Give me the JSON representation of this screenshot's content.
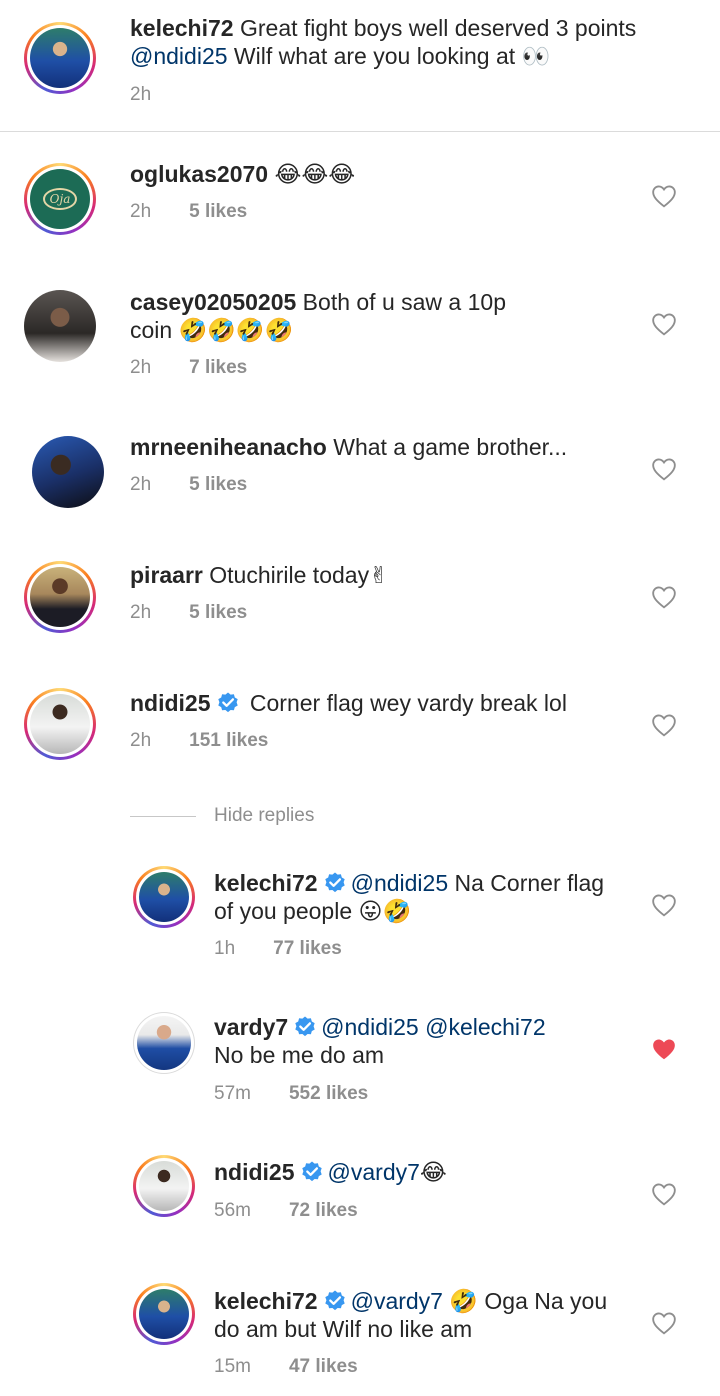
{
  "caption": {
    "username": "kelechi72",
    "text_line1": " Great fight boys well deserved 3 points",
    "mention": "@ndidi25",
    "text_line2_rest": " Wilf what are you looking at",
    "emoji": "👀",
    "time": "2h"
  },
  "comments": [
    {
      "username": "oglukas2070",
      "text": " ",
      "emoji": "😂😂😂",
      "time": "2h",
      "likes": "5 likes"
    },
    {
      "username": "casey02050205",
      "text_line1": " Both of u saw a 10p",
      "text_line2": "coin ",
      "emoji": "🤣🤣🤣🤣",
      "time": "2h",
      "likes": "7 likes"
    },
    {
      "username": "mrneeniheanacho",
      "text": " What a game brother...",
      "time": "2h",
      "likes": "5 likes"
    },
    {
      "username": "piraarr",
      "text": " Otuchirile today",
      "emoji": "✌",
      "time": "2h",
      "likes": "5 likes"
    },
    {
      "username": "ndidi25",
      "text": " Corner flag wey vardy break lol",
      "time": "2h",
      "likes": "151 likes"
    }
  ],
  "hide_replies": "Hide replies",
  "replies": [
    {
      "username": "kelechi72",
      "mention": "@ndidi25",
      "text_line1_rest": " Na Corner flag",
      "text_line2": "of you people ",
      "emoji": "😛🤣",
      "time": "1h",
      "likes": "77 likes"
    },
    {
      "username": "vardy7",
      "mention": "@ndidi25",
      "mention2": "@kelechi72",
      "text_line2": "No be me do am",
      "time": "57m",
      "likes": "552 likes",
      "liked": true
    },
    {
      "username": "ndidi25",
      "mention": "@vardy7",
      "emoji": "😂",
      "time": "56m",
      "likes": "72 likes"
    },
    {
      "username": "kelechi72",
      "mention": "@vardy7",
      "emoji": "🤣",
      "text_line1_rest": " Oga Na you",
      "text_line2": "do am but Wilf no like am",
      "time": "15m",
      "likes": "47 likes"
    }
  ],
  "colors": {
    "mention": "#003569",
    "heart_liked": "#ed4956",
    "verified": "#3897f0",
    "meta": "#8e8e8e"
  }
}
